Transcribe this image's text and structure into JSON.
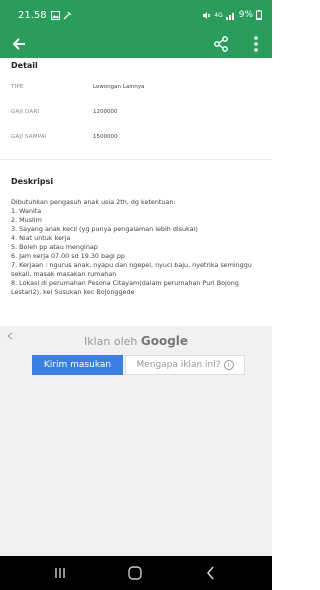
{
  "status_bar": {
    "time": "21.58",
    "battery": "9%",
    "network": "4G"
  },
  "app_bar": {
    "back_icon": "arrow-back-icon",
    "share_icon": "share-icon",
    "more_icon": "more-vert-icon"
  },
  "detail": {
    "title": "Detail",
    "rows": [
      {
        "label": "TIPE",
        "value": "Lowongan Lainnya"
      },
      {
        "label": "GAJI DARI",
        "value": "1200000"
      },
      {
        "label": "GAJI SAMPAI",
        "value": "1500000"
      }
    ]
  },
  "deskripsi": {
    "title": "Deskripsi",
    "lines": [
      "Dibutuhkan pengasuh anak usia 2th, dg ketentuan:",
      "1. Wanita",
      "2. Muslim",
      "3. Sayang anak kecil (yg punya pengalaman lebih disukai)",
      "4. Niat untuk kerja",
      "5. Boleh pp atau menginap",
      "6. Jam kerja 07.00 sd 19.30 bagi pp",
      "7. Kerjaan : ngurus anak, nyapu dan ngepel, nyuci baju, nyetrika seminggu sekali, masak masakan rumahan",
      "8. Lokasi di perumahan Pesona Citayam(dalam perumahan Puri Bojong Lestari2), kel Susukan kec Bojonggede"
    ]
  },
  "ad": {
    "title_prefix": "Iklan oleh",
    "title_brand": "Google",
    "feedback_button": "Kirim masukan",
    "why_button": "Mengapa iklan ini?",
    "info_symbol": "i"
  },
  "colors": {
    "primary": "#2a9d5c",
    "ad_blue": "#3b7fe0"
  }
}
